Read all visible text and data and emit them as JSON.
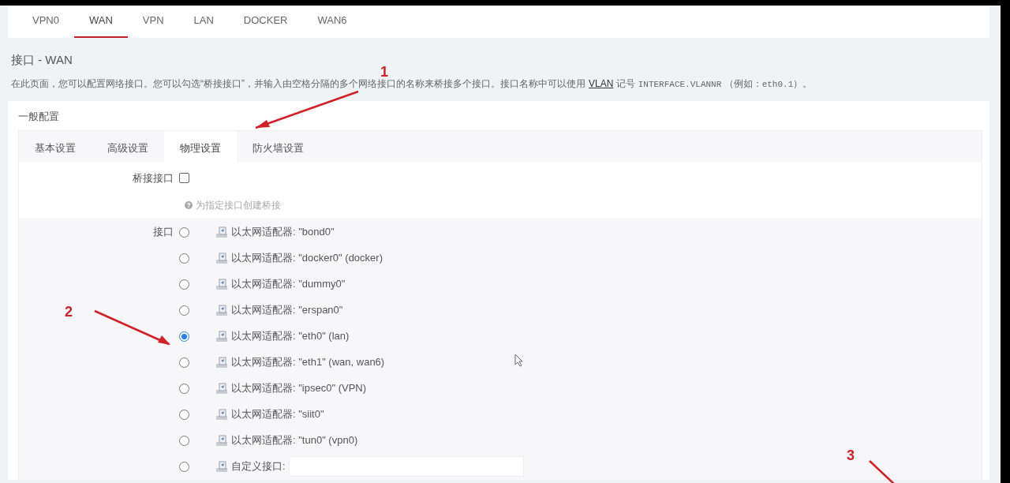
{
  "top_tabs": [
    {
      "label": "VPN0",
      "selected": false
    },
    {
      "label": "WAN",
      "selected": true
    },
    {
      "label": "VPN",
      "selected": false
    },
    {
      "label": "LAN",
      "selected": false
    },
    {
      "label": "DOCKER",
      "selected": false
    },
    {
      "label": "WAN6",
      "selected": false
    }
  ],
  "title": "接口 - WAN",
  "description": {
    "before": "在此页面，您可以配置网络接口。您可以勾选“桥接接口”，并输入由空格分隔的多个网络接口的名称来桥接多个接口。接口名称中可以使用",
    "link": "VLAN",
    "middle": "记号",
    "code": "INTERFACE.VLANNR",
    "after": "（例如：",
    "code2": "eth0.1",
    "end": "）。"
  },
  "section_title": "一般配置",
  "sub_tabs": [
    {
      "label": "基本设置",
      "selected": false
    },
    {
      "label": "高级设置",
      "selected": false
    },
    {
      "label": "物理设置",
      "selected": true
    },
    {
      "label": "防火墙设置",
      "selected": false
    }
  ],
  "bridge": {
    "label": "桥接接口",
    "checked": false,
    "help": "为指定接口创建桥接"
  },
  "interface": {
    "label": "接口",
    "options": [
      {
        "kind": "adapter",
        "text": "以太网适配器: \"bond0\"",
        "selected": false
      },
      {
        "kind": "adapter",
        "text": "以太网适配器: \"docker0\" (docker)",
        "selected": false
      },
      {
        "kind": "adapter",
        "text": "以太网适配器: \"dummy0\"",
        "selected": false
      },
      {
        "kind": "adapter",
        "text": "以太网适配器: \"erspan0\"",
        "selected": false
      },
      {
        "kind": "adapter",
        "text": "以太网适配器: \"eth0\" (lan)",
        "selected": true
      },
      {
        "kind": "adapter",
        "text": "以太网适配器: \"eth1\" (wan, wan6)",
        "selected": false
      },
      {
        "kind": "adapter",
        "text": "以太网适配器: \"ipsec0\" (VPN)",
        "selected": false
      },
      {
        "kind": "adapter",
        "text": "以太网适配器: \"siit0\"",
        "selected": false
      },
      {
        "kind": "adapter",
        "text": "以太网适配器: \"tun0\" (vpn0)",
        "selected": false
      },
      {
        "kind": "custom",
        "text": "自定义接口:",
        "selected": false
      }
    ]
  },
  "annotations": [
    {
      "label": "1"
    },
    {
      "label": "2"
    },
    {
      "label": "3"
    }
  ]
}
